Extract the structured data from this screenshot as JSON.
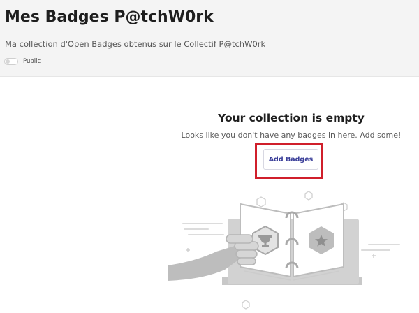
{
  "header": {
    "title": "Mes Badges P@tchW0rk",
    "subtitle": "Ma collection d'Open Badges obtenus sur le Collectif P@tchW0rk",
    "public_toggle": {
      "label": "Public",
      "on": false
    }
  },
  "empty_state": {
    "title": "Your collection is empty",
    "text": "Looks like you don't have any badges in here. Add some!",
    "add_button_label": "Add Badges",
    "illustration_icons": [
      "trophy-icon",
      "star-icon"
    ]
  },
  "colors": {
    "header_bg": "#f4f4f4",
    "button_text": "#3b3f99",
    "highlight": "#d01f2b",
    "illustration": "#c8c8c8"
  }
}
